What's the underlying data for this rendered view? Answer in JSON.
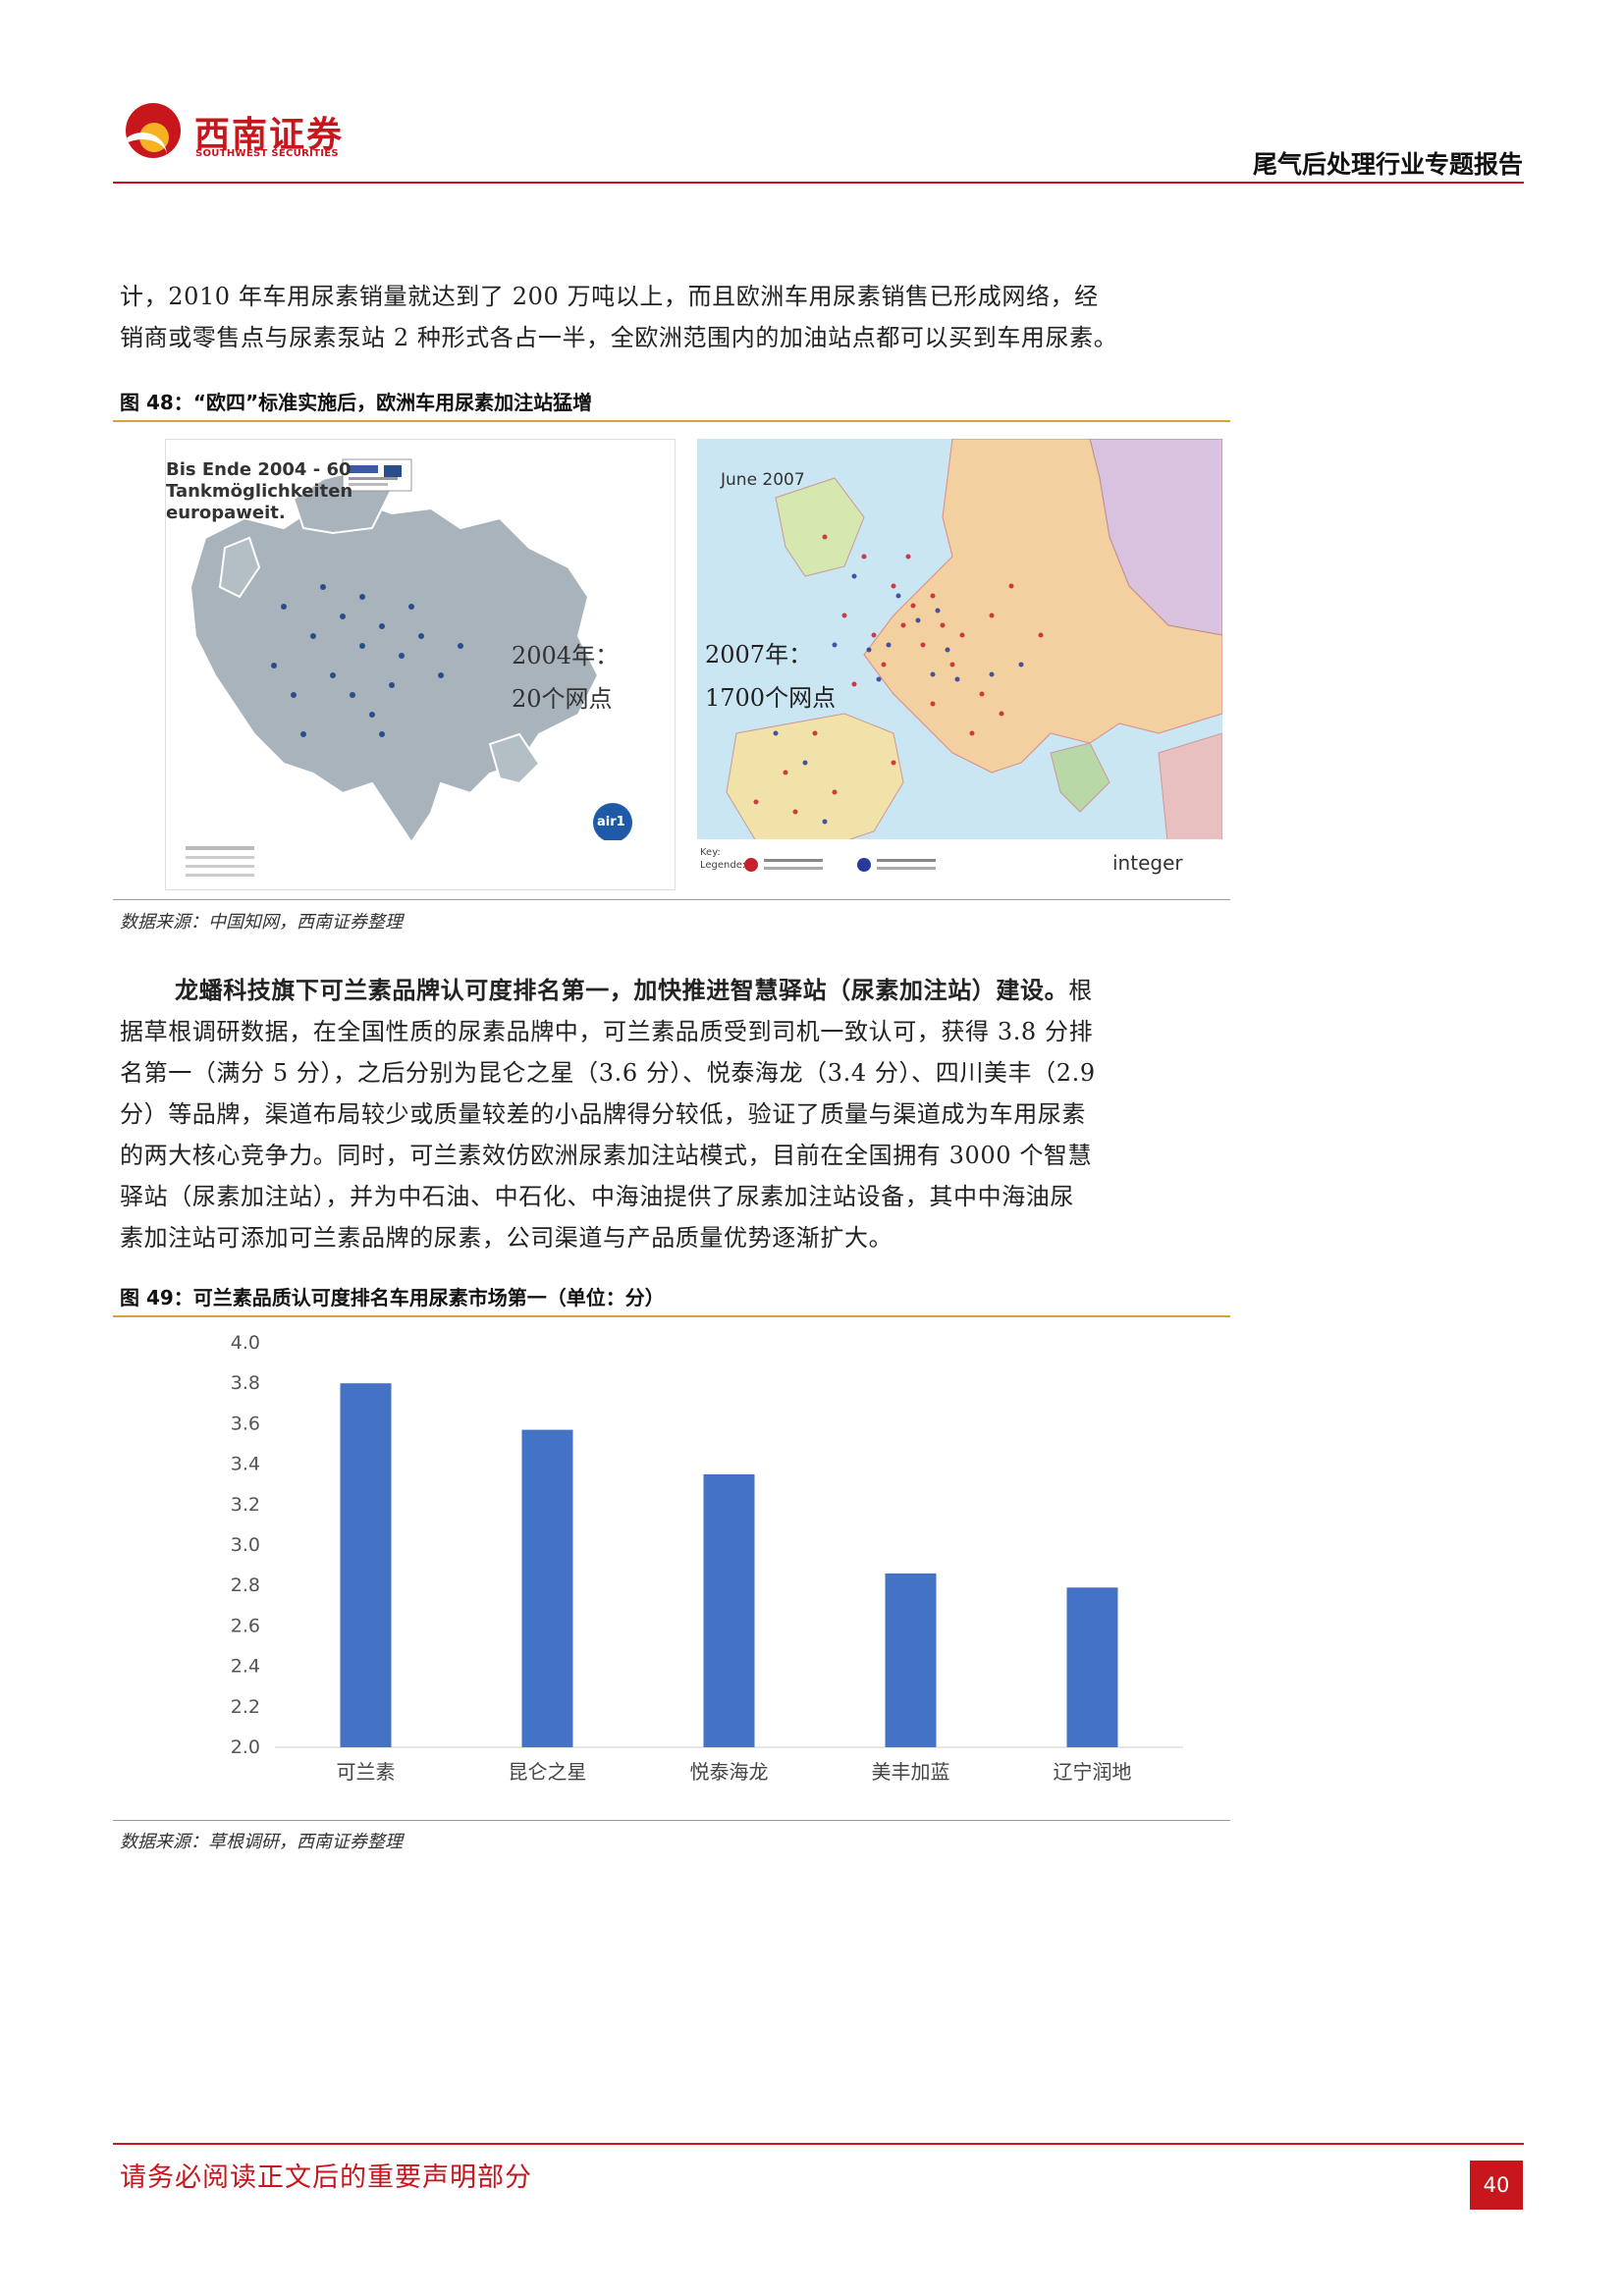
{
  "header": {
    "logo_cn": "西南证券",
    "logo_en": "SOUTHWEST SECURITIES",
    "report_title": "尾气后处理行业专题报告"
  },
  "intro": {
    "line1": "计，2010 年车用尿素销量就达到了 200 万吨以上，而且欧洲车用尿素销售已形成网络，经",
    "line2": "销商或零售点与尿素泵站 2 种形式各占一半，全欧洲范围内的加油站点都可以买到车用尿素。"
  },
  "figure48": {
    "caption": "图 48：“欧四”标准实施后，欧洲车用尿素加注站猛增",
    "left_map": {
      "heading": "Bis Ende 2004 - 60 Tankmöglichkeiten europaweit.",
      "label_year": "2004年：",
      "label_count": "20个网点",
      "brand": "air1"
    },
    "right_map": {
      "date": "June 2007",
      "label_year": "2007年：",
      "label_count": "1700个网点",
      "brand": "integer",
      "legend_key": "Key: Legende:"
    },
    "source": "数据来源：中国知网，西南证券整理"
  },
  "body_para": {
    "bold_lead": "龙蟠科技旗下可兰素品牌认可度排名第一，加快推进智慧驿站（尿素加注站）建设。",
    "lines": [
      "据草根调研数据，在全国性质的尿素品牌中，可兰素品质受到司机一致认可，获得 3.8 分排",
      "名第一（满分 5 分），之后分别为昆仑之星（3.6 分）、悦泰海龙（3.4 分）、四川美丰（2.9",
      "分）等品牌，渠道布局较少或质量较差的小品牌得分较低，验证了质量与渠道成为车用尿素",
      "的两大核心竞争力。同时，可兰素效仿欧洲尿素加注站模式，目前在全国拥有 3000 个智慧",
      "驿站（尿素加注站），并为中石油、中石化、中海油提供了尿素加注站设备，其中中海油尿",
      "素加注站可添加可兰素品牌的尿素，公司渠道与产品质量优势逐渐扩大。"
    ],
    "lead_tail": "根"
  },
  "figure49": {
    "caption": "图 49：可兰素品质认可度排名车用尿素市场第一（单位：分）",
    "source": "数据来源：草根调研，西南证券整理"
  },
  "chart_data": {
    "type": "bar",
    "categories": [
      "可兰素",
      "昆仑之星",
      "悦泰海龙",
      "美丰加蓝",
      "辽宁润地"
    ],
    "values": [
      3.8,
      3.57,
      3.35,
      2.86,
      2.79
    ],
    "yticks": [
      "4.0",
      "3.8",
      "3.6",
      "3.4",
      "3.2",
      "3.0",
      "2.8",
      "2.6",
      "2.4",
      "2.2",
      "2.0"
    ],
    "ylim": [
      2.0,
      4.0
    ],
    "bar_color": "#4472c4",
    "grid": false
  },
  "footer": {
    "disclaimer": "请务必阅读正文后的重要声明部分",
    "page_number": "40"
  },
  "colors": {
    "brand_red": "#c8161d",
    "caption_rule": "#d9a23a"
  }
}
